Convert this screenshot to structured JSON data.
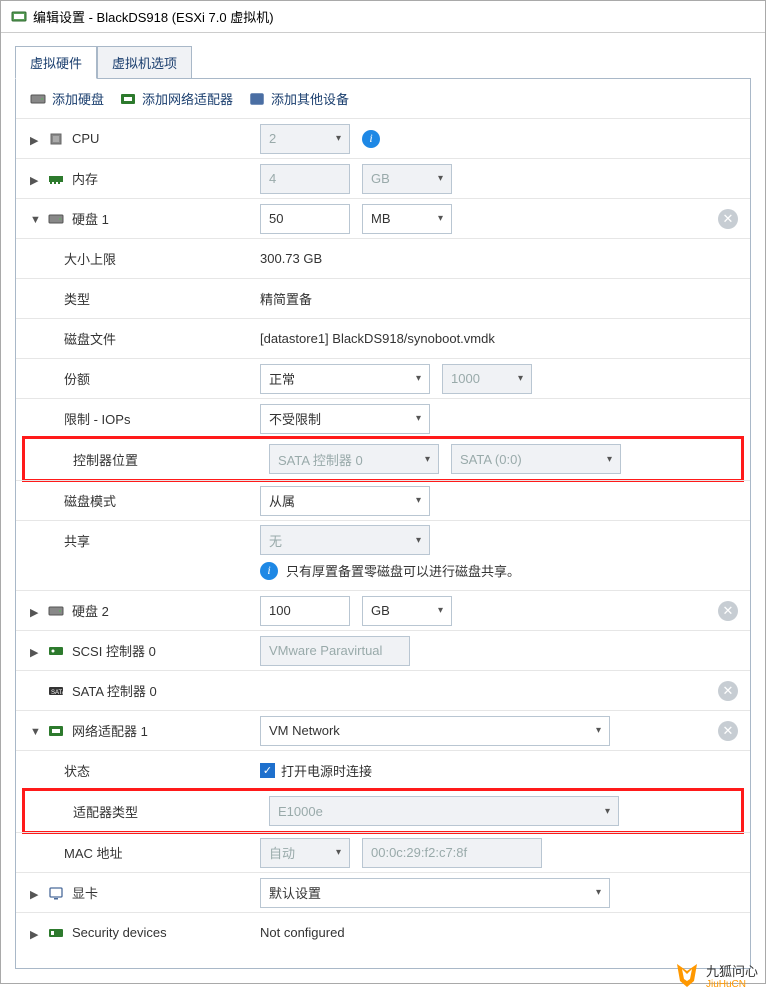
{
  "title": "编辑设置 - BlackDS918 (ESXi 7.0 虚拟机)",
  "tabs": {
    "hardware": "虚拟硬件",
    "options": "虚拟机选项"
  },
  "toolbar": {
    "add_disk": "添加硬盘",
    "add_nic": "添加网络适配器",
    "add_other": "添加其他设备"
  },
  "cpu": {
    "label": "CPU",
    "value": "2"
  },
  "memory": {
    "label": "内存",
    "value": "4",
    "unit": "GB"
  },
  "disk1": {
    "label": "硬盘 1",
    "size_value": "50",
    "unit": "MB",
    "maxsize": {
      "label": "大小上限",
      "value": "300.73 GB"
    },
    "type": {
      "label": "类型",
      "value": "精简置备"
    },
    "file": {
      "label": "磁盘文件",
      "value": "[datastore1] BlackDS918/synoboot.vmdk"
    },
    "share_quota": {
      "label": "份额",
      "mode": "正常",
      "value": "1000"
    },
    "iops": {
      "label": "限制 - IOPs",
      "value": "不受限制"
    },
    "controller_loc": {
      "label": "控制器位置",
      "controller": "SATA 控制器 0",
      "slot": "SATA (0:0)"
    },
    "mode": {
      "label": "磁盘模式",
      "value": "从属"
    },
    "sharing": {
      "label": "共享",
      "value": "无",
      "hint": "只有厚置备置零磁盘可以进行磁盘共享。"
    }
  },
  "disk2": {
    "label": "硬盘 2",
    "size_value": "100",
    "unit": "GB"
  },
  "scsi": {
    "label": "SCSI 控制器 0",
    "value": "VMware Paravirtual"
  },
  "sata": {
    "label": "SATA 控制器 0"
  },
  "nic1": {
    "label": "网络适配器 1",
    "network": "VM Network",
    "status": {
      "label": "状态",
      "checkbox_label": "打开电源时连接"
    },
    "adapter_type": {
      "label": "适配器类型",
      "value": "E1000e"
    },
    "mac": {
      "label": "MAC 地址",
      "mode": "自动",
      "value": "00:0c:29:f2:c7:8f"
    }
  },
  "video": {
    "label": "显卡",
    "value": "默认设置"
  },
  "security": {
    "label": "Security devices",
    "value": "Not configured"
  },
  "watermark": {
    "name": "九狐问心",
    "sub": "JiuHuCN"
  }
}
